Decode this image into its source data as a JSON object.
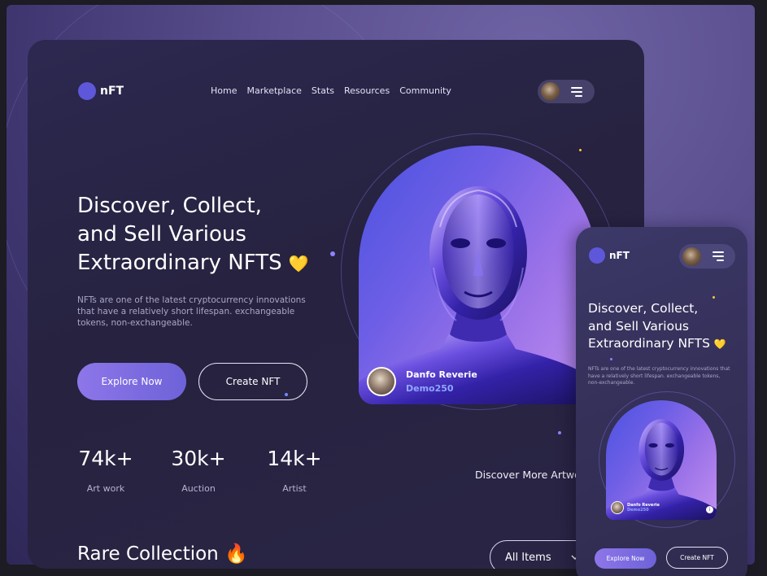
{
  "brand": {
    "name": "nFT",
    "logo_color": "#5f57d9"
  },
  "nav": {
    "items": [
      "Home",
      "Marketplace",
      "Stats",
      "Resources",
      "Community"
    ]
  },
  "header": {
    "menu_icon": "hamburger-icon",
    "avatar": "user-avatar"
  },
  "hero": {
    "title_line1": "Discover, Collect,",
    "title_line2": "and Sell Various",
    "title_line3": "Extraordinary NFTS",
    "title_emoji": "💛",
    "description": "NFTs are one of the latest cryptocurrency innovations that have a relatively short lifespan. exchangeable tokens, non-exchangeable.",
    "primary_button": "Explore Now",
    "secondary_button": "Create NFT"
  },
  "stats": [
    {
      "value": "74k+",
      "label": "Art work"
    },
    {
      "value": "30k+",
      "label": "Auction"
    },
    {
      "value": "14k+",
      "label": "Artist"
    }
  ],
  "featured": {
    "artist_name": "Danfo Reverie",
    "artist_handle": "Demo250"
  },
  "discover_more": "Discover More Artwo",
  "collection": {
    "title": "Rare Collection",
    "emoji": "🔥",
    "filter_value": "All Items"
  },
  "mobile": {
    "brand": "nFT",
    "title_line1": "Discover, Collect,",
    "title_line2": "and Sell Various",
    "title_line3": "Extraordinary NFTS",
    "title_emoji": "💛",
    "description": "NFTs are one of the latest cryptocurrency innovations that have a relatively short lifespan. exchangeable tokens, non-exchangeable.",
    "artist_name": "Danfo Reverie",
    "artist_handle": "Demo250",
    "info_icon": "i",
    "primary_button": "Explore Now",
    "secondary_button": "Create NFT"
  },
  "colors": {
    "accent": "#7b6ae0",
    "background": "#2a2545",
    "heart": "#f5c840",
    "handle": "#8fa7ff"
  }
}
